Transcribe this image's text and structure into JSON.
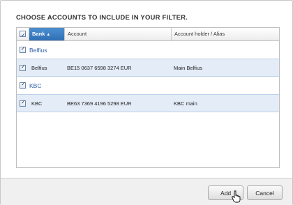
{
  "dialog": {
    "title": "CHOOSE ACCOUNTS TO INCLUDE IN YOUR FILTER."
  },
  "grid": {
    "columns": {
      "bank": "Bank",
      "account": "Account",
      "alias": "Account holder / Alias"
    },
    "groups": [
      {
        "name": "Belfius",
        "checked": true,
        "rows": [
          {
            "bank": "Belfius",
            "account": "BE15 0637 6598 3274 EUR",
            "alias": "Main Belfius",
            "checked": true
          }
        ]
      },
      {
        "name": "KBC",
        "checked": true,
        "rows": [
          {
            "bank": "KBC",
            "account": "BE63 7369 4196 5298 EUR",
            "alias": "KBC main",
            "checked": true
          }
        ]
      }
    ]
  },
  "buttons": {
    "add": "Add",
    "cancel": "Cancel"
  },
  "icons": {
    "sort": "sort-ascending-icon",
    "cursor": "hand-pointer-icon"
  },
  "colors": {
    "accent": "#2f6fb4",
    "row_bg": "#e3ecf7",
    "group_text": "#2d5fa8"
  }
}
